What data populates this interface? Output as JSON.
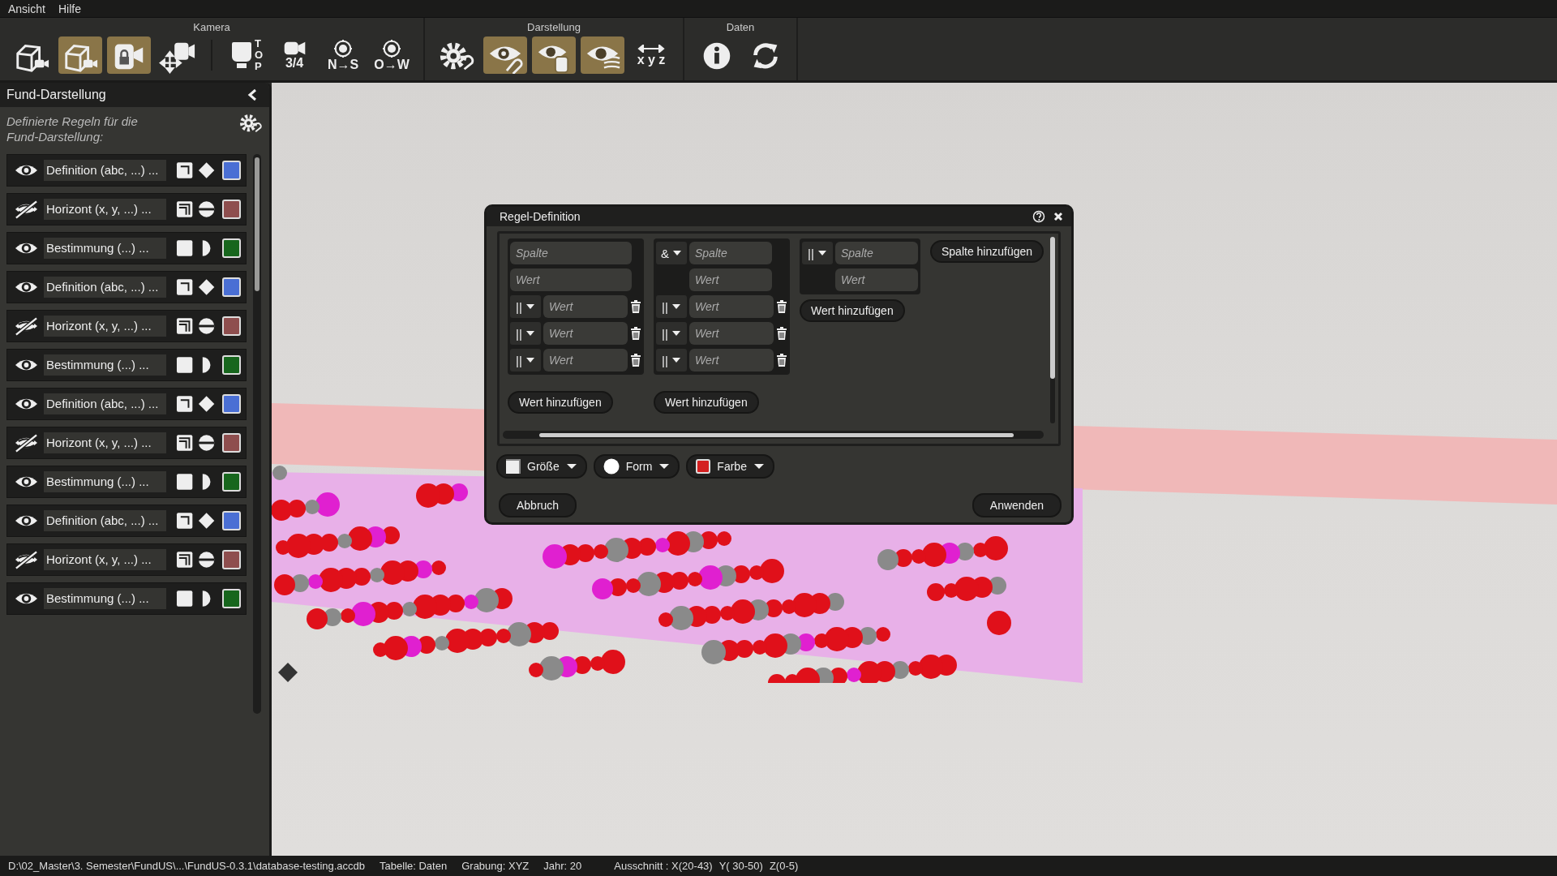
{
  "menu": [
    {
      "label": "Ansicht"
    },
    {
      "label": "Hilfe"
    }
  ],
  "toolbar": {
    "groups": [
      {
        "title": "Kamera",
        "sections": [
          [
            {
              "kind": "box-camera",
              "active": false
            },
            {
              "kind": "box-camera",
              "active": true
            },
            {
              "kind": "lock-camera",
              "active": true
            },
            {
              "kind": "move-camera",
              "active": false
            }
          ],
          [
            {
              "kind": "top",
              "caption": "TOP",
              "active": false
            },
            {
              "kind": "camera-caption",
              "caption": "3/4",
              "active": false
            },
            {
              "kind": "compass",
              "caption": "N→S",
              "active": false
            },
            {
              "kind": "compass",
              "caption": "O→W",
              "active": false
            }
          ]
        ]
      },
      {
        "title": "Darstellung",
        "sections": [
          [
            {
              "kind": "gear",
              "active": false
            },
            {
              "kind": "eye-pointer",
              "active": true
            },
            {
              "kind": "eye-bin",
              "active": true
            },
            {
              "kind": "eye-lines",
              "active": true
            },
            {
              "kind": "axes",
              "caption": "x y z",
              "active": false
            }
          ]
        ]
      },
      {
        "title": "Daten",
        "sections": [
          [
            {
              "kind": "info",
              "active": false
            },
            {
              "kind": "refresh",
              "active": false
            }
          ]
        ]
      }
    ]
  },
  "sidebar": {
    "title": "Fund-Darstellung",
    "description": "Definierte Regeln für die Fund-Darstellung:",
    "rules": [
      {
        "visible": true,
        "label": "Definition (abc, ...) ...",
        "size": {
          "kind": "frame"
        },
        "shape": {
          "kind": "diamond"
        },
        "color": "#4a6fd4"
      },
      {
        "visible": false,
        "label": "Horizont (x, y, ...) ...",
        "size": {
          "kind": "double-frame"
        },
        "shape": {
          "kind": "split-circle"
        },
        "color": "#8e4e4e"
      },
      {
        "visible": true,
        "label": "Bestimmung (...) ...",
        "size": {
          "kind": "filled"
        },
        "shape": {
          "kind": "half-circle"
        },
        "color": "#17661d"
      },
      {
        "visible": true,
        "label": "Definition (abc, ...) ...",
        "size": {
          "kind": "frame"
        },
        "shape": {
          "kind": "diamond"
        },
        "color": "#4a6fd4"
      },
      {
        "visible": false,
        "label": "Horizont (x, y, ...) ...",
        "size": {
          "kind": "double-frame"
        },
        "shape": {
          "kind": "split-circle"
        },
        "color": "#8e4e4e"
      },
      {
        "visible": true,
        "label": "Bestimmung (...) ...",
        "size": {
          "kind": "filled"
        },
        "shape": {
          "kind": "half-circle"
        },
        "color": "#17661d"
      },
      {
        "visible": true,
        "label": "Definition (abc, ...) ...",
        "size": {
          "kind": "frame"
        },
        "shape": {
          "kind": "diamond"
        },
        "color": "#4a6fd4"
      },
      {
        "visible": false,
        "label": "Horizont (x, y, ...) ...",
        "size": {
          "kind": "double-frame"
        },
        "shape": {
          "kind": "split-circle"
        },
        "color": "#8e4e4e"
      },
      {
        "visible": true,
        "label": "Bestimmung (...) ...",
        "size": {
          "kind": "filled"
        },
        "shape": {
          "kind": "half-circle"
        },
        "color": "#17661d"
      },
      {
        "visible": true,
        "label": "Definition (abc, ...) ...",
        "size": {
          "kind": "frame"
        },
        "shape": {
          "kind": "diamond"
        },
        "color": "#4a6fd4"
      },
      {
        "visible": false,
        "label": "Horizont (x, y, ...) ...",
        "size": {
          "kind": "double-frame"
        },
        "shape": {
          "kind": "split-circle"
        },
        "color": "#8e4e4e"
      },
      {
        "visible": true,
        "label": "Bestimmung (...) ...",
        "size": {
          "kind": "filled"
        },
        "shape": {
          "kind": "half-circle"
        },
        "color": "#17661d"
      }
    ]
  },
  "dialog": {
    "title": "Regel-Definition",
    "columns": [
      {
        "column_placeholder": "Spalte",
        "value_placeholder": "Wert",
        "extra_values": [
          {
            "operator": "||",
            "placeholder": "Wert"
          },
          {
            "operator": "||",
            "placeholder": "Wert"
          },
          {
            "operator": "||",
            "placeholder": "Wert"
          }
        ],
        "add_button": "Wert hinzufügen"
      },
      {
        "operator": "&",
        "column_placeholder": "Spalte",
        "value_placeholder": "Wert",
        "extra_values": [
          {
            "operator": "||",
            "placeholder": "Wert"
          },
          {
            "operator": "||",
            "placeholder": "Wert"
          },
          {
            "operator": "||",
            "placeholder": "Wert"
          }
        ],
        "add_button": "Wert hinzufügen"
      },
      {
        "operator": "||",
        "column_placeholder": "Spalte",
        "value_placeholder": "Wert",
        "add_button": "Wert hinzufügen"
      }
    ],
    "add_column_button": "Spalte hinzufügen",
    "pickers": [
      {
        "kind": "size",
        "label": "Größe"
      },
      {
        "kind": "shape",
        "label": "Form"
      },
      {
        "kind": "color",
        "label": "Farbe",
        "color": "#d42020"
      }
    ],
    "cancel_button": "Abbruch",
    "apply_button": "Anwenden"
  },
  "status_bar": {
    "file": "D:\\02_Master\\3. Semester\\FundUS\\...\\FundUS-0.3.1\\database-testing.accdb",
    "fields": [
      "Tabelle: Daten",
      "Grabung: XYZ",
      "Jahr: 20"
    ],
    "extent": [
      "Ausschnitt : X(20-43)",
      "Y( 30-50)",
      "Z(0-5)"
    ]
  }
}
